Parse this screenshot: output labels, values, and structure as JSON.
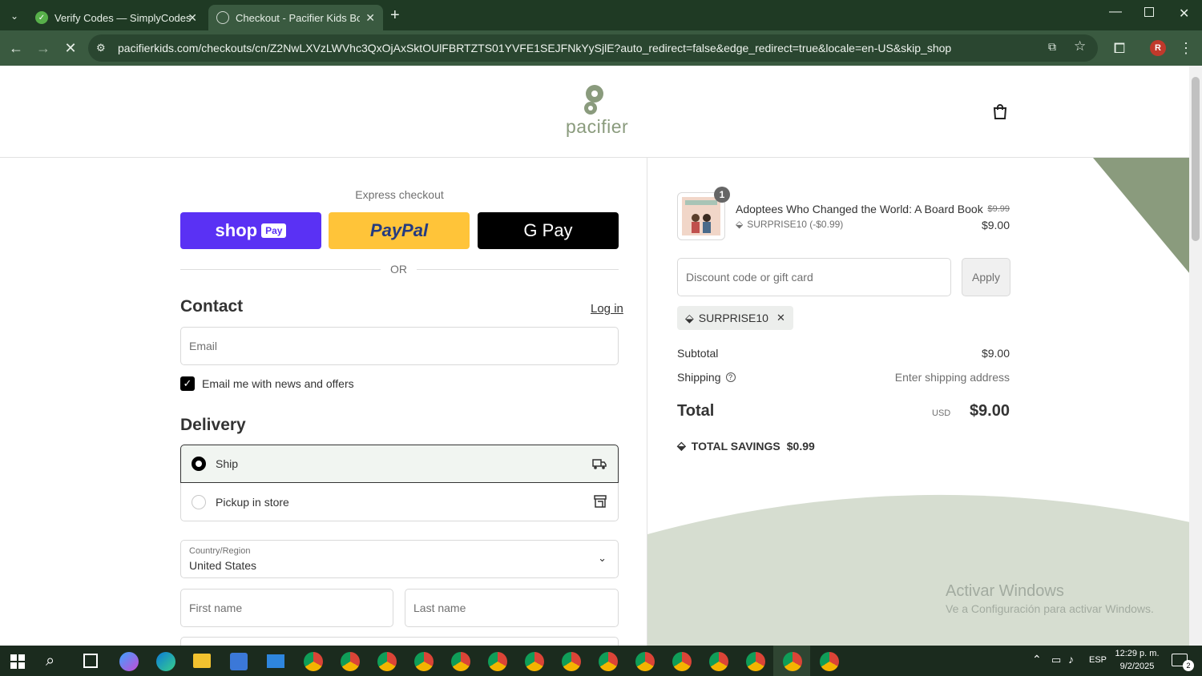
{
  "browser": {
    "tabs": [
      {
        "title": "Verify Codes — SimplyCodes",
        "active": false
      },
      {
        "title": "Checkout - Pacifier Kids Boutiqu",
        "active": true
      }
    ],
    "url": "pacifierkids.com/checkouts/cn/Z2NwLXVzLWVhc3QxOjAxSktOUlFBRTZTS01YVFE1SEJFNkYySjlE?auto_redirect=false&edge_redirect=true&locale=en-US&skip_shop_pay=true",
    "profile_initial": "R"
  },
  "header": {
    "logo_text": "pacifier",
    "brand_color": "#8a9b7d"
  },
  "express": {
    "title": "Express checkout",
    "shop_label": "shop",
    "shop_badge": "Pay",
    "paypal_label": "PayPal",
    "gpay_label": "G Pay",
    "or": "OR"
  },
  "contact": {
    "heading": "Contact",
    "login": "Log in",
    "email_placeholder": "Email",
    "news_label": "Email me with news and offers",
    "news_checked": true
  },
  "delivery": {
    "heading": "Delivery",
    "options": [
      {
        "label": "Ship",
        "selected": true,
        "icon": "truck-icon"
      },
      {
        "label": "Pickup in store",
        "selected": false,
        "icon": "store-icon"
      }
    ],
    "country_label": "Country/Region",
    "country_value": "United States",
    "first_name_placeholder": "First name",
    "last_name_placeholder": "Last name"
  },
  "summary": {
    "item": {
      "quantity": "1",
      "title": "Adoptees Who Changed the World: A Board Book",
      "discount": "SURPRISE10 (-$0.99)",
      "original_price": "$9.99",
      "price": "$9.00"
    },
    "discount_placeholder": "Discount code or gift card",
    "apply": "Apply",
    "applied_code": "SURPRISE10",
    "subtotal_label": "Subtotal",
    "subtotal_value": "$9.00",
    "shipping_label": "Shipping",
    "shipping_value": "Enter shipping address",
    "total_label": "Total",
    "currency": "USD",
    "total_value": "$9.00",
    "savings_label": "TOTAL SAVINGS",
    "savings_value": "$0.99"
  },
  "watermark": {
    "line1": "Activar Windows",
    "line2": "Ve a Configuración para activar Windows."
  },
  "taskbar": {
    "language": "ESP",
    "time": "12:29 p. m.",
    "date": "9/2/2025",
    "notifications": "2"
  }
}
